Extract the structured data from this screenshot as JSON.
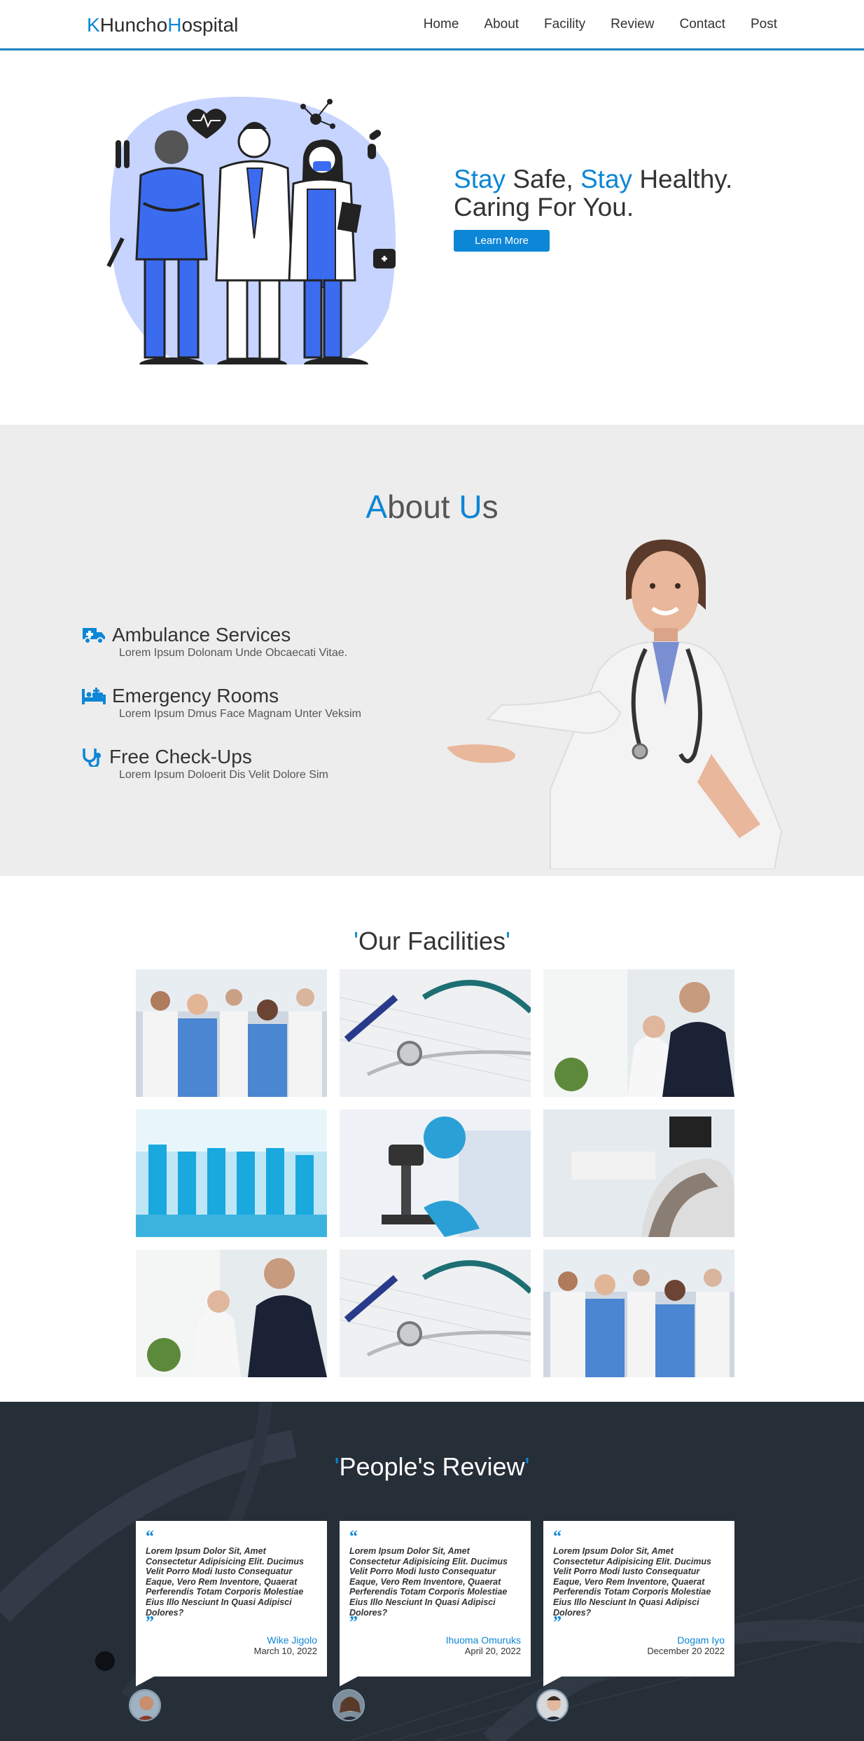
{
  "header": {
    "logo": {
      "k": "K",
      "huncho": "Huncho",
      "h": "H",
      "ospital": "ospital"
    },
    "nav": [
      "Home",
      "About",
      "Facility",
      "Review",
      "Contact",
      "Post"
    ]
  },
  "hero": {
    "w1": "Stay",
    "w2": " Safe, ",
    "w3": "Stay",
    "w4": " Healthy.",
    "line2": "Caring For You.",
    "cta": "Learn More"
  },
  "about": {
    "title_a": "A",
    "title_bout": "bout ",
    "title_u": "U",
    "title_s": "s",
    "services": [
      {
        "title": "Ambulance Services",
        "desc": "Lorem Ipsum Dolonam Unde Obcaecati Vitae.",
        "icon": "ambulance-icon"
      },
      {
        "title": "Emergency Rooms",
        "desc": "Lorem Ipsum Dmus Face Magnam Unter Veksim",
        "icon": "bed-icon"
      },
      {
        "title": "Free Check-Ups",
        "desc": "Lorem Ipsum Doloerit Dis Velit Dolore Sim",
        "icon": "stethoscope-icon"
      }
    ]
  },
  "facilities": {
    "q1": "'",
    "title": "Our Facilities",
    "q2": "'"
  },
  "reviews": {
    "q1": "'",
    "title": "People's Review",
    "q2": "'",
    "items": [
      {
        "text": "Lorem Ipsum Dolor Sit, Amet Consectetur Adipisicing Elit. Ducimus Velit Porro Modi Iusto Consequatur Eaque, Vero Rem Inventore, Quaerat Perferendis Totam Corporis Molestiae Eius Illo Nesciunt In Quasi Adipisci Dolores?",
        "name": "Wike Jigolo",
        "date": "March 10, 2022"
      },
      {
        "text": "Lorem Ipsum Dolor Sit, Amet Consectetur Adipisicing Elit. Ducimus Velit Porro Modi Iusto Consequatur Eaque, Vero Rem Inventore, Quaerat Perferendis Totam Corporis Molestiae Eius Illo Nesciunt In Quasi Adipisci Dolores?",
        "name": "Ihuoma Omuruks",
        "date": "April 20, 2022"
      },
      {
        "text": "Lorem Ipsum Dolor Sit, Amet Consectetur Adipisicing Elit. Ducimus Velit Porro Modi Iusto Consequatur Eaque, Vero Rem Inventore, Quaerat Perferendis Totam Corporis Molestiae Eius Illo Nesciunt In Quasi Adipisci Dolores?",
        "name": "Dogam Iyo",
        "date": "December 20 2022"
      }
    ],
    "quote_open": "“",
    "quote_close": "”"
  },
  "colors": {
    "accent": "#0c86d6",
    "header_border": "#1b82c2",
    "about_bg": "#ededed",
    "review_bg": "#262e38",
    "illus_blue": "#3b6cf0",
    "illus_blob": "#c6d4ff"
  }
}
